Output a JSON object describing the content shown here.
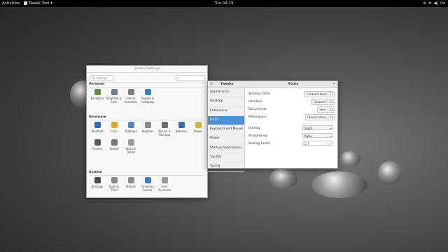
{
  "topbar": {
    "activities": "Activities",
    "app_menu": "Tweak Tool",
    "clock": "Tue 04:19"
  },
  "system_settings": {
    "title": "System Settings",
    "all_settings": "All Settings",
    "sections": [
      {
        "name": "Personal",
        "items": [
          {
            "label": "Backgrou",
            "icon": "background-icon",
            "color": "#5f8f3e"
          },
          {
            "label": "Brightne & Lock",
            "icon": "brightness-lock-icon",
            "color": "#6d7c8a"
          },
          {
            "label": "Online Accounts",
            "icon": "online-accounts-icon",
            "color": "#7a7f87"
          },
          {
            "label": "Region & Languag",
            "icon": "region-language-icon",
            "color": "#3d7fc4"
          }
        ]
      },
      {
        "name": "Hardware",
        "items": [
          {
            "label": "Bluetoot",
            "icon": "bluetooth-icon",
            "color": "#2e6db5"
          },
          {
            "label": "Color",
            "icon": "color-icon",
            "color": "#e2a32a"
          },
          {
            "label": "Displays",
            "icon": "displays-icon",
            "color": "#4f86c6"
          },
          {
            "label": "Keyboar",
            "icon": "keyboard-icon",
            "color": "#8a8a8a"
          },
          {
            "label": "Mouse & Touchpa",
            "icon": "mouse-icon",
            "color": "#6c6c6c"
          },
          {
            "label": "Network",
            "icon": "network-icon",
            "color": "#3b6ea8"
          },
          {
            "label": "Power",
            "icon": "power-icon",
            "color": "#d0b340"
          },
          {
            "label": "Printers",
            "icon": "printers-icon",
            "color": "#555a60"
          },
          {
            "label": "Sound",
            "icon": "sound-icon",
            "color": "#777777"
          },
          {
            "label": "Wacom Tablet",
            "icon": "wacom-tablet-icon",
            "color": "#9a9a9a"
          }
        ]
      },
      {
        "name": "System",
        "items": [
          {
            "label": "Backups",
            "icon": "backups-icon",
            "color": "#4a4a4a"
          },
          {
            "label": "Date & Time",
            "icon": "date-time-icon",
            "color": "#888888"
          },
          {
            "label": "Details",
            "icon": "details-icon",
            "color": "#8f8f8f"
          },
          {
            "label": "Universa Access",
            "icon": "universal-access-icon",
            "color": "#3d7fc4"
          },
          {
            "label": "User Accounts",
            "icon": "user-accounts-icon",
            "color": "#9a9a9a"
          }
        ]
      }
    ]
  },
  "tweak_tool": {
    "title": "Tweaks",
    "panel_title": "Fonts",
    "sidebar": [
      "Appearance",
      "Desktop",
      "Extensions",
      "Fonts",
      "Keyboard and Mouse",
      "Power",
      "Startup Applications",
      "Top Bar",
      "Typing"
    ],
    "selected": "Fonts",
    "fonts": [
      {
        "key": "Window Titles",
        "font": "Cantarell Bold",
        "size": "17"
      },
      {
        "key": "Interface",
        "font": "Cantarell",
        "size": "11"
      },
      {
        "key": "Documents",
        "font": "Sans",
        "size": "11"
      },
      {
        "key": "Monospace",
        "font": "Ubuntu Mono",
        "size": "13"
      }
    ],
    "hinting": {
      "key": "Hinting",
      "value": "Slight"
    },
    "antialiasing": {
      "key": "Antialiasing",
      "value": "Rgba"
    },
    "scaling": {
      "key": "Scaling Factor",
      "value": "1.7"
    }
  }
}
